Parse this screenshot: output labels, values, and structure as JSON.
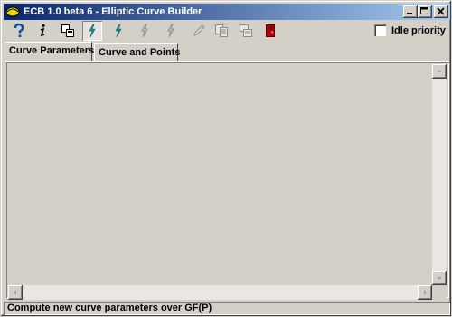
{
  "window": {
    "title": "ECB 1.0 beta 6 - Elliptic Curve Builder"
  },
  "toolbar": {
    "buttons": [
      {
        "icon": "help-icon",
        "enabled": true
      },
      {
        "icon": "info-icon",
        "enabled": true
      },
      {
        "icon": "copy-icon",
        "enabled": true
      },
      {
        "icon": "lightning-icon",
        "enabled": true,
        "pressed": true
      },
      {
        "icon": "lightning-icon",
        "enabled": true
      },
      {
        "icon": "lightning-icon",
        "enabled": false
      },
      {
        "icon": "lightning-icon",
        "enabled": false
      },
      {
        "icon": "pen-icon",
        "enabled": false
      },
      {
        "icon": "copy-pages-icon",
        "enabled": false
      },
      {
        "icon": "paste-icon",
        "enabled": false
      },
      {
        "icon": "exit-icon",
        "enabled": true
      }
    ],
    "idle_priority_label": "Idle priority",
    "idle_priority_checked": false
  },
  "tabs": [
    {
      "label": "Curve Parameters",
      "active": true
    },
    {
      "label": "Curve and Points",
      "active": false
    }
  ],
  "status": {
    "text": "Compute new curve parameters over GF(P)"
  },
  "colors": {
    "titlebar_start": "#0a246a",
    "titlebar_end": "#a6caf0",
    "face": "#d4d0c8",
    "lightning_enabled": "#1a8f8f",
    "exit_red": "#c00000"
  }
}
